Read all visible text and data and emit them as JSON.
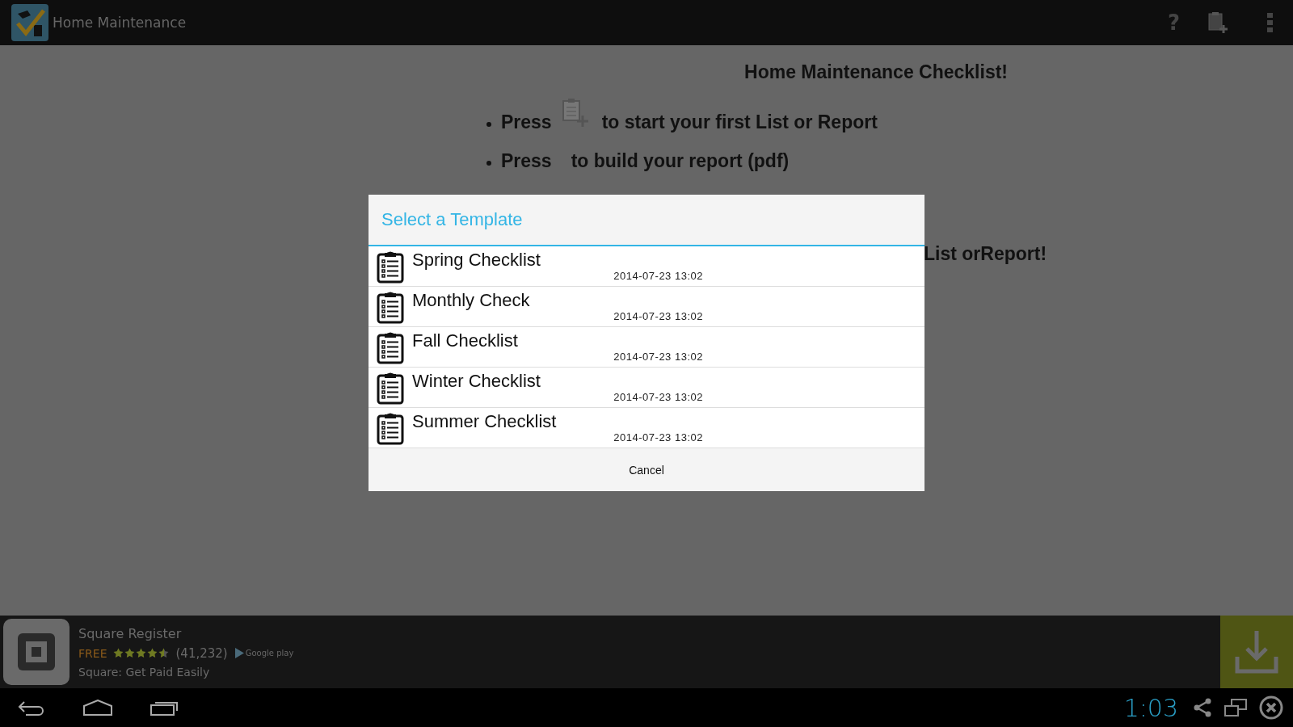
{
  "app_bar": {
    "title": "Home Maintenance",
    "actions": [
      "?"
    ]
  },
  "content": {
    "heading": "Home Maintenance Checklist!",
    "bullets": [
      {
        "kind": "icon",
        "before": "Press",
        "after": "to start your first List or Report"
      },
      {
        "kind": "plain",
        "before": "Press",
        "after": "to build your report (pdf)"
      }
    ],
    "hidden_line": "List orReport!"
  },
  "dialog": {
    "title": "Select a Template",
    "items": [
      {
        "name": "Spring Checklist",
        "date": "2014-07-23 13:02"
      },
      {
        "name": "Monthly Check",
        "date": "2014-07-23 13:02"
      },
      {
        "name": "Fall Checklist",
        "date": "2014-07-23 13:02"
      },
      {
        "name": "Winter Checklist",
        "date": "2014-07-23 13:02"
      },
      {
        "name": "Summer Checklist",
        "date": "2014-07-23 13:02"
      }
    ],
    "cancel": "Cancel"
  },
  "ad": {
    "title": "Square Register",
    "price": "FREE",
    "stars": 4.5,
    "reviews": "(41,232)",
    "store": "Google play",
    "subtitle": "Square: Get Paid Easily"
  },
  "nav_bar": {
    "time": "1:03"
  }
}
